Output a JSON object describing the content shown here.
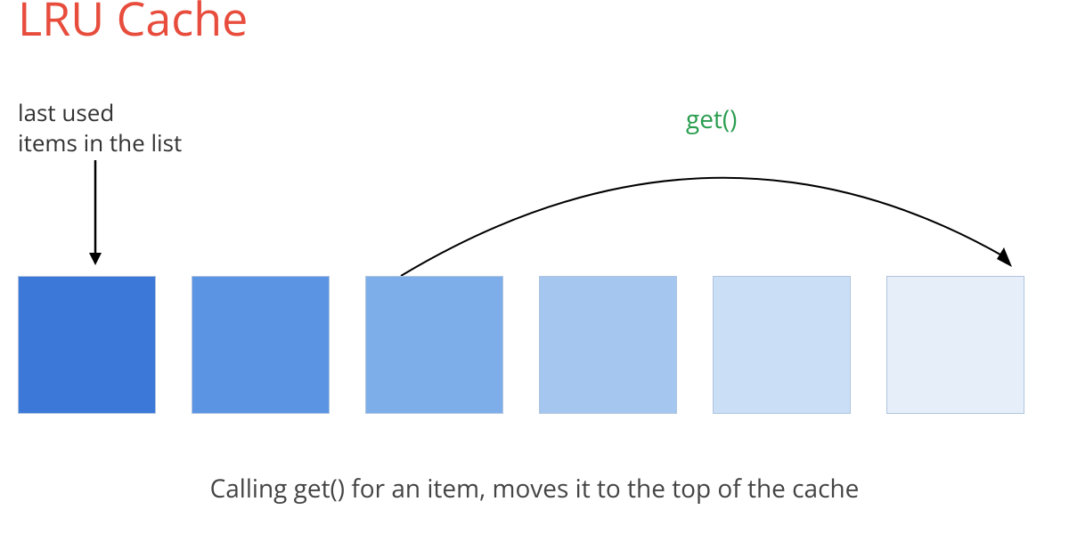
{
  "title": "LRU Cache",
  "label_left_line1": "last used",
  "label_left_line2": "items in the list",
  "label_get": "get()",
  "caption": "Calling get() for an item, moves it to the top of the cache",
  "boxes": {
    "count": 6,
    "colors": [
      "#3b78d8",
      "#5a94e3",
      "#7eaee9",
      "#a5c6ef",
      "#cadef6",
      "#e6eff9"
    ]
  },
  "colors": {
    "title": "#e74c3c",
    "get_label": "#2a9d4f",
    "text": "#333333",
    "box_border": "#b0c4de"
  }
}
